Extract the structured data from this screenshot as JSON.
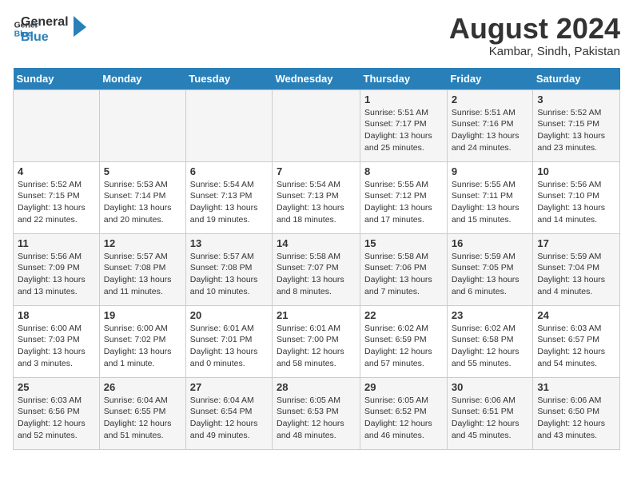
{
  "header": {
    "logo_line1": "General",
    "logo_line2": "Blue",
    "month_year": "August 2024",
    "location": "Kambar, Sindh, Pakistan"
  },
  "weekdays": [
    "Sunday",
    "Monday",
    "Tuesday",
    "Wednesday",
    "Thursday",
    "Friday",
    "Saturday"
  ],
  "weeks": [
    [
      {
        "day": "",
        "content": ""
      },
      {
        "day": "",
        "content": ""
      },
      {
        "day": "",
        "content": ""
      },
      {
        "day": "",
        "content": ""
      },
      {
        "day": "1",
        "content": "Sunrise: 5:51 AM\nSunset: 7:17 PM\nDaylight: 13 hours\nand 25 minutes."
      },
      {
        "day": "2",
        "content": "Sunrise: 5:51 AM\nSunset: 7:16 PM\nDaylight: 13 hours\nand 24 minutes."
      },
      {
        "day": "3",
        "content": "Sunrise: 5:52 AM\nSunset: 7:15 PM\nDaylight: 13 hours\nand 23 minutes."
      }
    ],
    [
      {
        "day": "4",
        "content": "Sunrise: 5:52 AM\nSunset: 7:15 PM\nDaylight: 13 hours\nand 22 minutes."
      },
      {
        "day": "5",
        "content": "Sunrise: 5:53 AM\nSunset: 7:14 PM\nDaylight: 13 hours\nand 20 minutes."
      },
      {
        "day": "6",
        "content": "Sunrise: 5:54 AM\nSunset: 7:13 PM\nDaylight: 13 hours\nand 19 minutes."
      },
      {
        "day": "7",
        "content": "Sunrise: 5:54 AM\nSunset: 7:13 PM\nDaylight: 13 hours\nand 18 minutes."
      },
      {
        "day": "8",
        "content": "Sunrise: 5:55 AM\nSunset: 7:12 PM\nDaylight: 13 hours\nand 17 minutes."
      },
      {
        "day": "9",
        "content": "Sunrise: 5:55 AM\nSunset: 7:11 PM\nDaylight: 13 hours\nand 15 minutes."
      },
      {
        "day": "10",
        "content": "Sunrise: 5:56 AM\nSunset: 7:10 PM\nDaylight: 13 hours\nand 14 minutes."
      }
    ],
    [
      {
        "day": "11",
        "content": "Sunrise: 5:56 AM\nSunset: 7:09 PM\nDaylight: 13 hours\nand 13 minutes."
      },
      {
        "day": "12",
        "content": "Sunrise: 5:57 AM\nSunset: 7:08 PM\nDaylight: 13 hours\nand 11 minutes."
      },
      {
        "day": "13",
        "content": "Sunrise: 5:57 AM\nSunset: 7:08 PM\nDaylight: 13 hours\nand 10 minutes."
      },
      {
        "day": "14",
        "content": "Sunrise: 5:58 AM\nSunset: 7:07 PM\nDaylight: 13 hours\nand 8 minutes."
      },
      {
        "day": "15",
        "content": "Sunrise: 5:58 AM\nSunset: 7:06 PM\nDaylight: 13 hours\nand 7 minutes."
      },
      {
        "day": "16",
        "content": "Sunrise: 5:59 AM\nSunset: 7:05 PM\nDaylight: 13 hours\nand 6 minutes."
      },
      {
        "day": "17",
        "content": "Sunrise: 5:59 AM\nSunset: 7:04 PM\nDaylight: 13 hours\nand 4 minutes."
      }
    ],
    [
      {
        "day": "18",
        "content": "Sunrise: 6:00 AM\nSunset: 7:03 PM\nDaylight: 13 hours\nand 3 minutes."
      },
      {
        "day": "19",
        "content": "Sunrise: 6:00 AM\nSunset: 7:02 PM\nDaylight: 13 hours\nand 1 minute."
      },
      {
        "day": "20",
        "content": "Sunrise: 6:01 AM\nSunset: 7:01 PM\nDaylight: 13 hours\nand 0 minutes."
      },
      {
        "day": "21",
        "content": "Sunrise: 6:01 AM\nSunset: 7:00 PM\nDaylight: 12 hours\nand 58 minutes."
      },
      {
        "day": "22",
        "content": "Sunrise: 6:02 AM\nSunset: 6:59 PM\nDaylight: 12 hours\nand 57 minutes."
      },
      {
        "day": "23",
        "content": "Sunrise: 6:02 AM\nSunset: 6:58 PM\nDaylight: 12 hours\nand 55 minutes."
      },
      {
        "day": "24",
        "content": "Sunrise: 6:03 AM\nSunset: 6:57 PM\nDaylight: 12 hours\nand 54 minutes."
      }
    ],
    [
      {
        "day": "25",
        "content": "Sunrise: 6:03 AM\nSunset: 6:56 PM\nDaylight: 12 hours\nand 52 minutes."
      },
      {
        "day": "26",
        "content": "Sunrise: 6:04 AM\nSunset: 6:55 PM\nDaylight: 12 hours\nand 51 minutes."
      },
      {
        "day": "27",
        "content": "Sunrise: 6:04 AM\nSunset: 6:54 PM\nDaylight: 12 hours\nand 49 minutes."
      },
      {
        "day": "28",
        "content": "Sunrise: 6:05 AM\nSunset: 6:53 PM\nDaylight: 12 hours\nand 48 minutes."
      },
      {
        "day": "29",
        "content": "Sunrise: 6:05 AM\nSunset: 6:52 PM\nDaylight: 12 hours\nand 46 minutes."
      },
      {
        "day": "30",
        "content": "Sunrise: 6:06 AM\nSunset: 6:51 PM\nDaylight: 12 hours\nand 45 minutes."
      },
      {
        "day": "31",
        "content": "Sunrise: 6:06 AM\nSunset: 6:50 PM\nDaylight: 12 hours\nand 43 minutes."
      }
    ]
  ]
}
